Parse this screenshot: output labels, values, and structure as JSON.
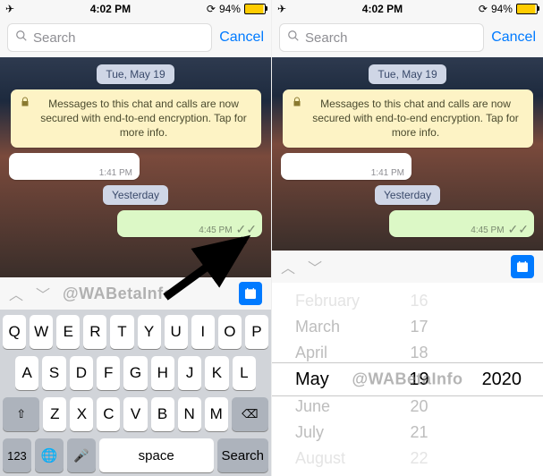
{
  "status": {
    "airplane": "✈︎",
    "time": "4:02 PM",
    "ring_icon": "⟳",
    "battery_pct": "94%"
  },
  "search": {
    "placeholder": "Search",
    "cancel": "Cancel"
  },
  "chat": {
    "date1": "Tue, May 19",
    "encryption": "Messages to this chat and calls are now secured with end-to-end encryption. Tap for more info.",
    "in_time": "1:41 PM",
    "date2": "Yesterday",
    "out_time": "4:45 PM"
  },
  "watermark": "@WABetaInfo",
  "keyboard": {
    "row1": [
      "Q",
      "W",
      "E",
      "R",
      "T",
      "Y",
      "U",
      "I",
      "O",
      "P"
    ],
    "row2": [
      "A",
      "S",
      "D",
      "F",
      "G",
      "H",
      "J",
      "K",
      "L"
    ],
    "row3": [
      "Z",
      "X",
      "C",
      "V",
      "B",
      "N",
      "M"
    ],
    "shift": "⇧",
    "backspace": "⌫",
    "numbers": "123",
    "globe": "🌐",
    "mic": "🎤",
    "space": "space",
    "search": "Search"
  },
  "picker": {
    "months": [
      "February",
      "March",
      "April",
      "May",
      "June",
      "July",
      "August"
    ],
    "days": [
      "16",
      "17",
      "18",
      "19",
      "20",
      "21",
      "22"
    ],
    "year": "2020",
    "selected_index": 3
  }
}
